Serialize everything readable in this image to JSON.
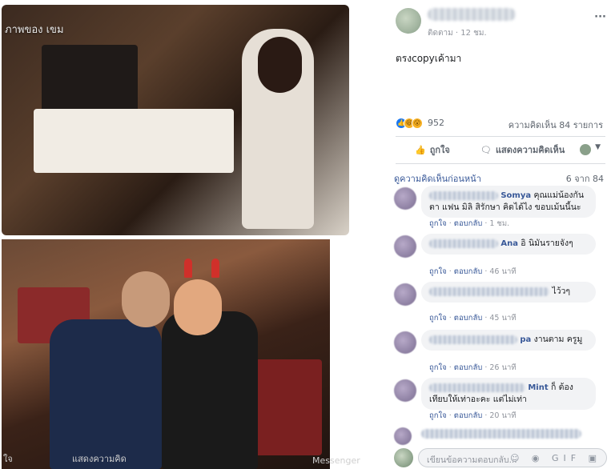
{
  "photos": {
    "top_caption": "ภาพของ เขม",
    "footer_left": "ใจ",
    "footer_mid": "แสดงความคิด",
    "footer_right": "Messenger"
  },
  "post": {
    "meta": "ติดตาม · 12 ชม.",
    "options": "···",
    "text": "ตรงcopyเค้ามา",
    "reaction_count": "952",
    "comment_count": "ความคิดเห็น 84 รายการ",
    "reaction_icons": [
      "like-icon",
      "haha-icon",
      "wow-icon"
    ]
  },
  "actions": {
    "like_label": "ถูกใจ",
    "comment_label": "แสดงความคิดเห็น",
    "like_icon": "👍",
    "comment_icon": "🗨"
  },
  "previous": {
    "link": "ดูความคิดเห็นก่อนหน้า",
    "count": "6 จาก 84"
  },
  "comments": [
    {
      "name_suffix": "Somya",
      "text": "คุณแม่น้องกันตา แฟน มิลิ สิรักษา คิดได้ไง ขอบเม้นนี้นะ",
      "time": "1 ชม."
    },
    {
      "name_suffix": "Ana",
      "text": "อิ นิมันรายจังๆ",
      "time": "46 นาที"
    },
    {
      "name_suffix": "",
      "text": "ไว้วๆ",
      "time": "45 นาที"
    },
    {
      "name_suffix": "pa",
      "text": "งานตาม ครูมู",
      "time": "26 นาที"
    },
    {
      "name_suffix": "Mint",
      "text": "ก็ ต้องเทียบให้เท่าอะคะ แต่ไม่เท่า",
      "time": "20 นาที"
    }
  ],
  "comment_actions": {
    "like": "ถูกใจ",
    "reply": "ตอบกลับ",
    "sep": " · "
  },
  "composer": {
    "placeholder": "เขียนข้อความตอบกลับ...",
    "icons": "☺ ◉ GIF ▣"
  },
  "colors": {
    "link": "#385898",
    "muted": "#90949c",
    "bubble": "#f2f3f5",
    "like_blue": "#1877f2"
  }
}
